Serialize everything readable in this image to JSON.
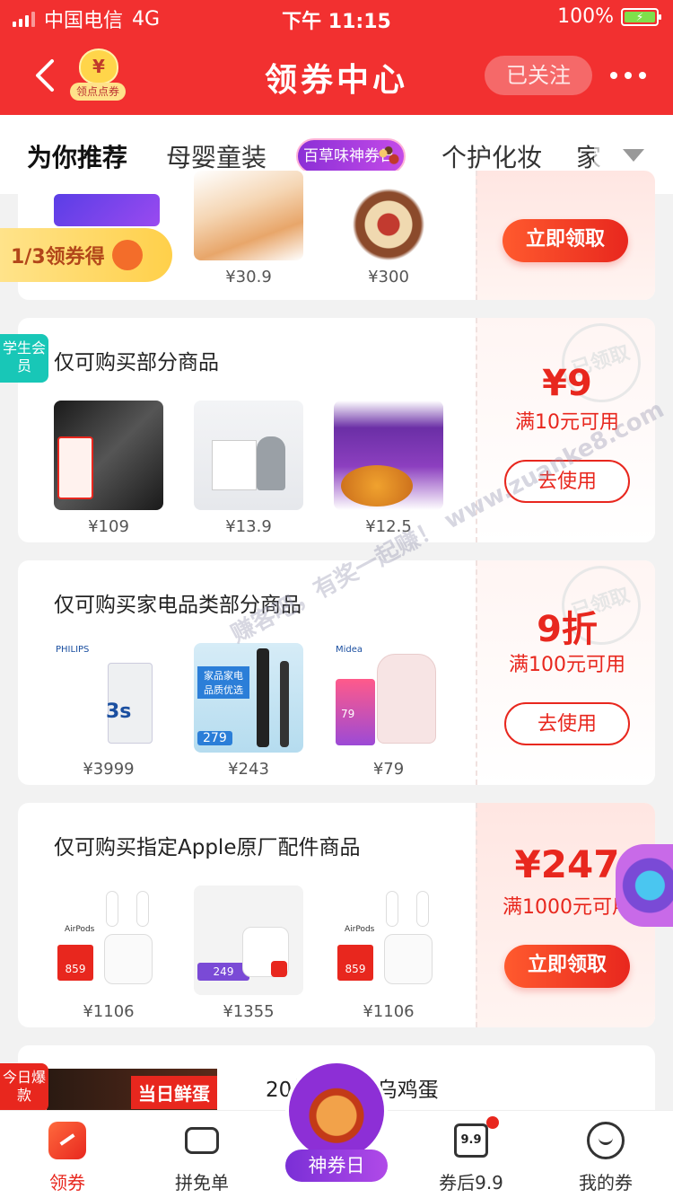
{
  "status": {
    "carrier": "中国电信",
    "network": "4G",
    "time": "下午 11:15",
    "battery": "100%"
  },
  "header": {
    "title": "领券中心",
    "badge_label": "领点点券",
    "follow_label": "已关注"
  },
  "tabs": [
    {
      "label": "为你推荐",
      "active": true
    },
    {
      "label": "母婴童装"
    },
    {
      "label": "百草味神券日",
      "special": true
    },
    {
      "label": "个护化妆"
    },
    {
      "label": "家"
    }
  ],
  "promo_ribbon": "1/3领券得",
  "cards": [
    {
      "prices": [
        "¥30.9",
        "¥300"
      ],
      "cta": "立即领取"
    },
    {
      "side_tag": "学生会员",
      "title": "仅可购买部分商品",
      "prices": [
        "¥109",
        "¥13.9",
        "¥12.5"
      ],
      "amount": "¥9",
      "condition": "满10元可用",
      "stamp": "已领取",
      "cta": "去使用"
    },
    {
      "title": "仅可购买家电品类部分商品",
      "prices": [
        "¥3999",
        "¥243",
        "¥79"
      ],
      "amount": "9折",
      "condition": "满100元可用",
      "stamp": "已领取",
      "cta": "去使用",
      "product_texts": [
        "PHILIPS",
        "3s",
        "家品家电品质优选",
        "279",
        "Midea",
        "79"
      ]
    },
    {
      "title": "仅可购买指定Apple原厂配件商品",
      "prices": [
        "¥1106",
        "¥1355",
        "¥1106"
      ],
      "amount": "¥247",
      "condition": "满1000元可用",
      "cta": "立即领取",
      "product_texts": [
        "AirPods",
        "859",
        "249",
        "AirPods",
        "859"
      ]
    },
    {
      "side_tag": "今日爆款",
      "title": "20枚+20枚乌鸡蛋",
      "banner": "当日鲜蛋"
    }
  ],
  "watermark": "赚客吧，有奖一起赚！ www.zuanke8.com",
  "bottom_nav": [
    {
      "label": "领券",
      "active": true
    },
    {
      "label": "拼免单"
    },
    {
      "label": "神券日"
    },
    {
      "label": "券后9.9"
    },
    {
      "label": "我的券"
    }
  ],
  "colors": {
    "brand_red": "#f23030",
    "accent_red": "#e8271e",
    "purple": "#8b2fd6"
  }
}
